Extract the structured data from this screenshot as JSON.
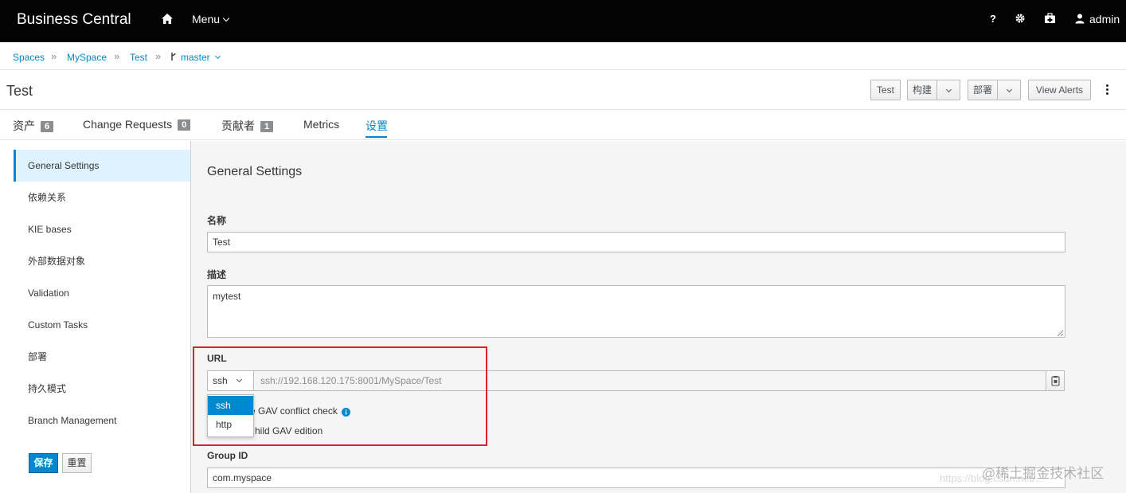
{
  "topbar": {
    "brand": "Business Central",
    "menu_label": "Menu",
    "user": "admin",
    "icons": [
      "home-icon",
      "help-icon",
      "gear-icon",
      "medkit-icon",
      "user-icon"
    ]
  },
  "breadcrumb": {
    "items": [
      "Spaces",
      "MySpace",
      "Test"
    ],
    "branch": "master",
    "separator": "»"
  },
  "title_row": {
    "title": "Test",
    "buttons": {
      "test": "Test",
      "build": "构建",
      "deploy": "部署",
      "view_alerts": "View Alerts"
    }
  },
  "tabs": [
    {
      "label": "资产",
      "count": "6"
    },
    {
      "label": "Change Requests",
      "count": "0"
    },
    {
      "label": "贡献者",
      "count": "1"
    },
    {
      "label": "Metrics"
    },
    {
      "label": "设置",
      "active": true
    }
  ],
  "sidebar": {
    "items": [
      {
        "label": "General Settings",
        "active": true
      },
      {
        "label": "依赖关系"
      },
      {
        "label": "KIE bases"
      },
      {
        "label": "外部数据对象"
      },
      {
        "label": "Validation"
      },
      {
        "label": "Custom Tasks"
      },
      {
        "label": "部署"
      },
      {
        "label": "持久模式"
      },
      {
        "label": "Branch Management"
      }
    ],
    "save_label": "保存",
    "reset_label": "重置"
  },
  "main": {
    "section_title": "General Settings",
    "name_label": "名称",
    "name_value": "Test",
    "desc_label": "描述",
    "desc_value": "mytest",
    "url_label": "URL",
    "protocol_selected": "ssh",
    "protocol_options": [
      "ssh",
      "http"
    ],
    "url_value": "ssh://192.168.120.175:8001/MySpace/Test",
    "gav_conflict_text": "e GAV conflict check",
    "child_gav_text": "hild GAV edition",
    "group_id_label": "Group ID",
    "group_id_value": "com.myspace"
  },
  "colors": {
    "accent": "#0088ce",
    "highlight": "#d6262b",
    "topbar": "#030303"
  },
  "watermark": {
    "main": "@稀土掘金技术社区",
    "sub": "https://blog.csdn.net/..."
  }
}
